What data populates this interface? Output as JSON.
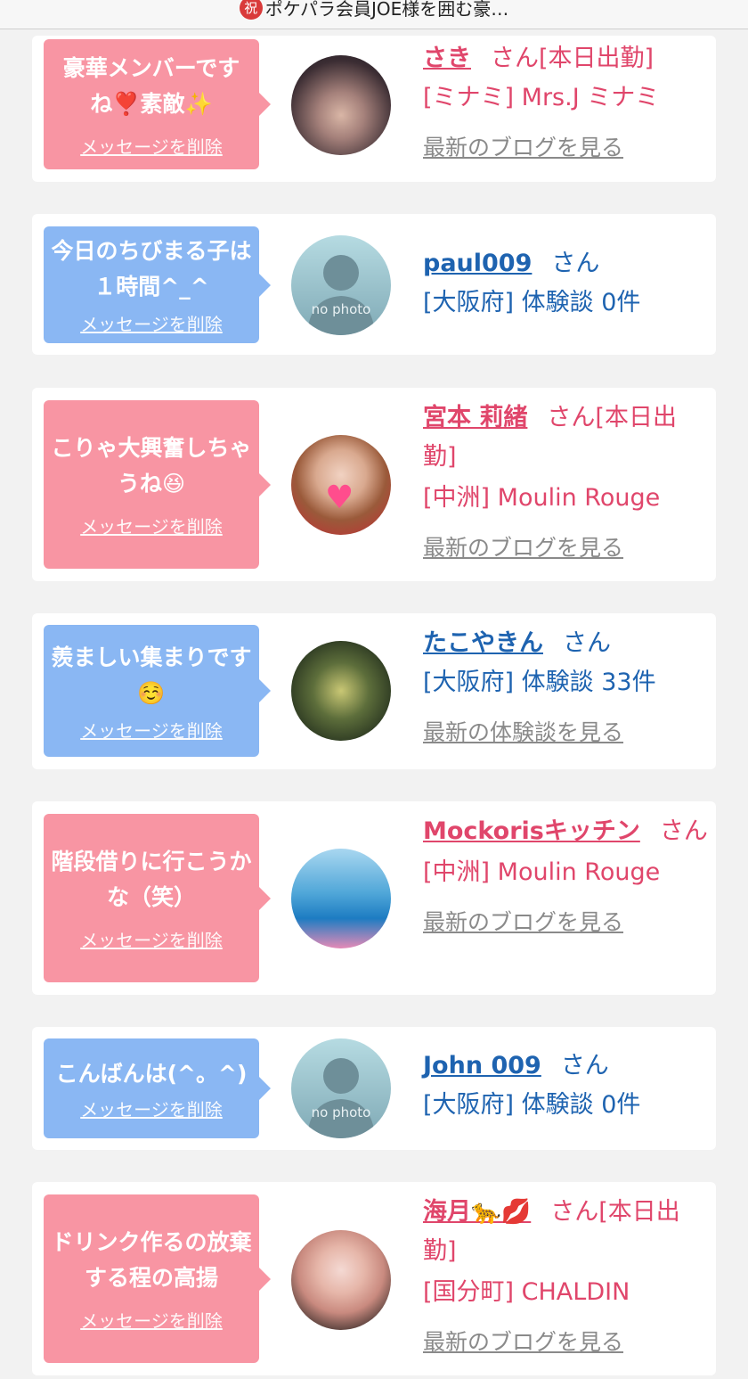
{
  "header": {
    "badge": "祝",
    "title": "ポケパラ会員JOE様を囲む豪…"
  },
  "cards": [
    {
      "message": "豪華メンバーですね❣️素敵✨",
      "delete": "メッセージを削除",
      "name": "さき",
      "suffix": "さん[本日出勤]",
      "detail": "[ミナミ] Mrs.J ミナミ",
      "link": "最新のブログを見る"
    },
    {
      "message": "今日のちびまる子は１時間^_^",
      "delete": "メッセージを削除",
      "name": "paul009",
      "suffix": "さん",
      "detail": "[大阪府] 体験談 0件",
      "avatar_label": "no photo"
    },
    {
      "message": "こりゃ大興奮しちゃうね😆",
      "delete": "メッセージを削除",
      "name": "宮本 莉緒",
      "suffix": "さん[本日出勤]",
      "detail": "[中洲] Moulin Rouge",
      "link": "最新のブログを見る"
    },
    {
      "message": "羨ましい集まりです☺️",
      "delete": "メッセージを削除",
      "name": "たこやきん",
      "suffix": "さん",
      "detail": "[大阪府] 体験談 33件",
      "link": "最新の体験談を見る"
    },
    {
      "message": "階段借りに行こうかな（笑）",
      "delete": "メッセージを削除",
      "name": "Mockorisキッチン",
      "suffix": "さん",
      "detail": "[中洲] Moulin Rouge",
      "link": "最新のブログを見る"
    },
    {
      "message": "こんばんは(^。^)",
      "delete": "メッセージを削除",
      "name": "John 009",
      "suffix": "さん",
      "detail": "[大阪府] 体験談 0件",
      "avatar_label": "no photo"
    },
    {
      "message": "ドリンク作るの放棄する程の高揚",
      "delete": "メッセージを削除",
      "name": "海月🐆💋",
      "suffix": "さん[本日出勤]",
      "detail": "[国分町] CHALDIN",
      "link": "最新のブログを見る"
    }
  ]
}
